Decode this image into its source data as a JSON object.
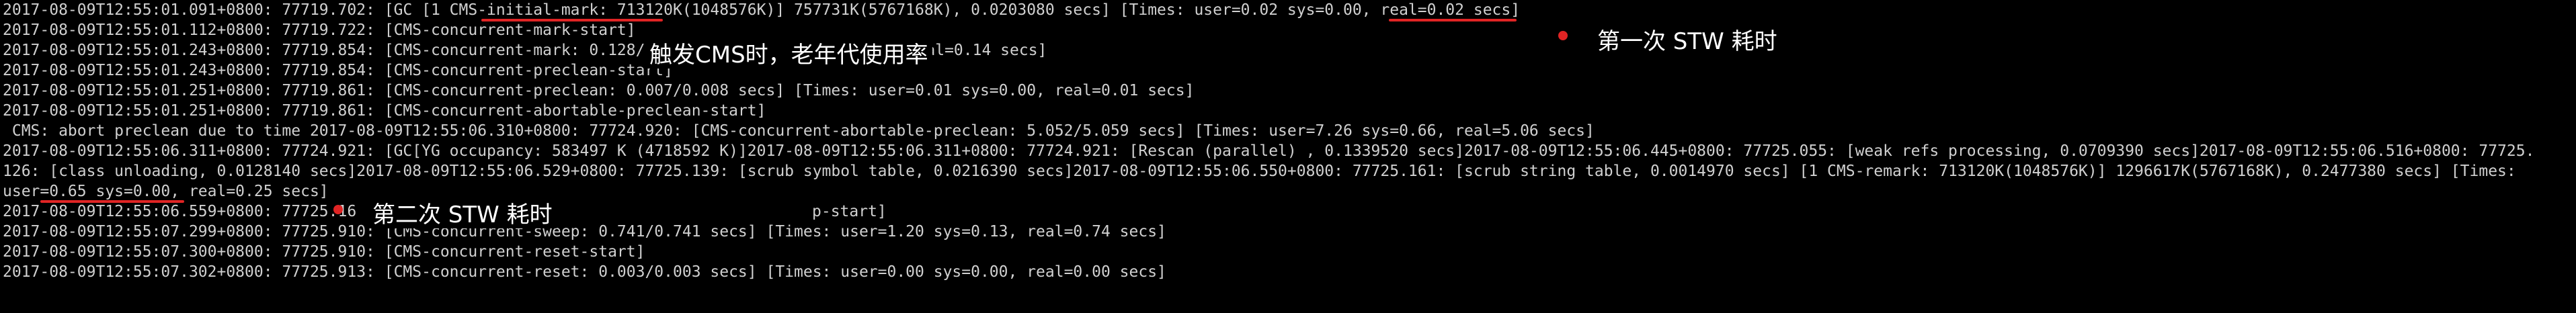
{
  "colors": {
    "background": "#000000",
    "log_text": "#d0d0d0",
    "annotation_text": "#ffffff",
    "highlight": "#e02424"
  },
  "log_lines": [
    "2017-08-09T12:55:01.091+0800: 77719.702: [GC [1 CMS-initial-mark: 713120K(1048576K)] 757731K(5767168K), 0.0203080 secs] [Times: user=0.02 sys=0.00, real=0.02 secs]",
    "2017-08-09T12:55:01.112+0800: 77719.722: [CMS-concurrent-mark-start]",
    "2017-08-09T12:55:01.243+0800: 77719.854: [CMS-concurrent-mark: 0.128/0.1",
    "2017-08-09T12:55:01.243+0800: 77719.854: [CMS-concurrent-preclean-start]",
    "2017-08-09T12:55:01.251+0800: 77719.861: [CMS-concurrent-preclean: 0.007/0.008 secs] [Times: user=0.01 sys=0.00, real=0.01 secs]",
    "2017-08-09T12:55:01.251+0800: 77719.861: [CMS-concurrent-abortable-preclean-start]",
    " CMS: abort preclean due to time 2017-08-09T12:55:06.310+0800: 77724.920: [CMS-concurrent-abortable-preclean: 5.052/5.059 secs] [Times: user=7.26 sys=0.66, real=5.06 secs]",
    "2017-08-09T12:55:06.311+0800: 77724.921: [GC[YG occupancy: 583497 K (4718592 K)]2017-08-09T12:55:06.311+0800: 77724.921: [Rescan (parallel) , 0.1339520 secs]2017-08-09T12:55:06.445+0800: 77725.055: [weak refs processing, 0.0709390 secs]2017-08-09T12:55:06.516+0800: 77725.",
    "126: [class unloading, 0.0128140 secs]2017-08-09T12:55:06.529+0800: 77725.139: [scrub symbol table, 0.0216390 secs]2017-08-09T12:55:06.550+0800: 77725.161: [scrub string table, 0.0014970 secs] [1 CMS-remark: 713120K(1048576K)] 1296617K(5767168K), 0.2477380 secs] [Times:",
    "user=0.65 sys=0.00, real=0.25 secs]",
    "2017-08-09T12:55:06.559+0800: 77725.16",
    "2017-08-09T12:55:07.299+0800: 77725.910: [CMS-concurrent-sweep: 0.741/0.741 secs] [Times: user=1.20 sys=0.13, real=0.74 secs]",
    "2017-08-09T12:55:07.300+0800: 77725.910: [CMS-concurrent-reset-start]",
    "2017-08-09T12:55:07.302+0800: 77725.913: [CMS-concurrent-reset: 0.003/0.003 secs] [Times: user=0.00 sys=0.00, real=0.00 secs]"
  ],
  "partial_fragments": {
    "mark_tail": ", real=0.14 secs]",
    "sweep_start_tail": "p-start]"
  },
  "annotations": {
    "first_stw": "第一次 STW 耗时",
    "trigger_cms": "触发CMS时，老年代使用率",
    "second_stw": "第二次 STW 耗时"
  }
}
